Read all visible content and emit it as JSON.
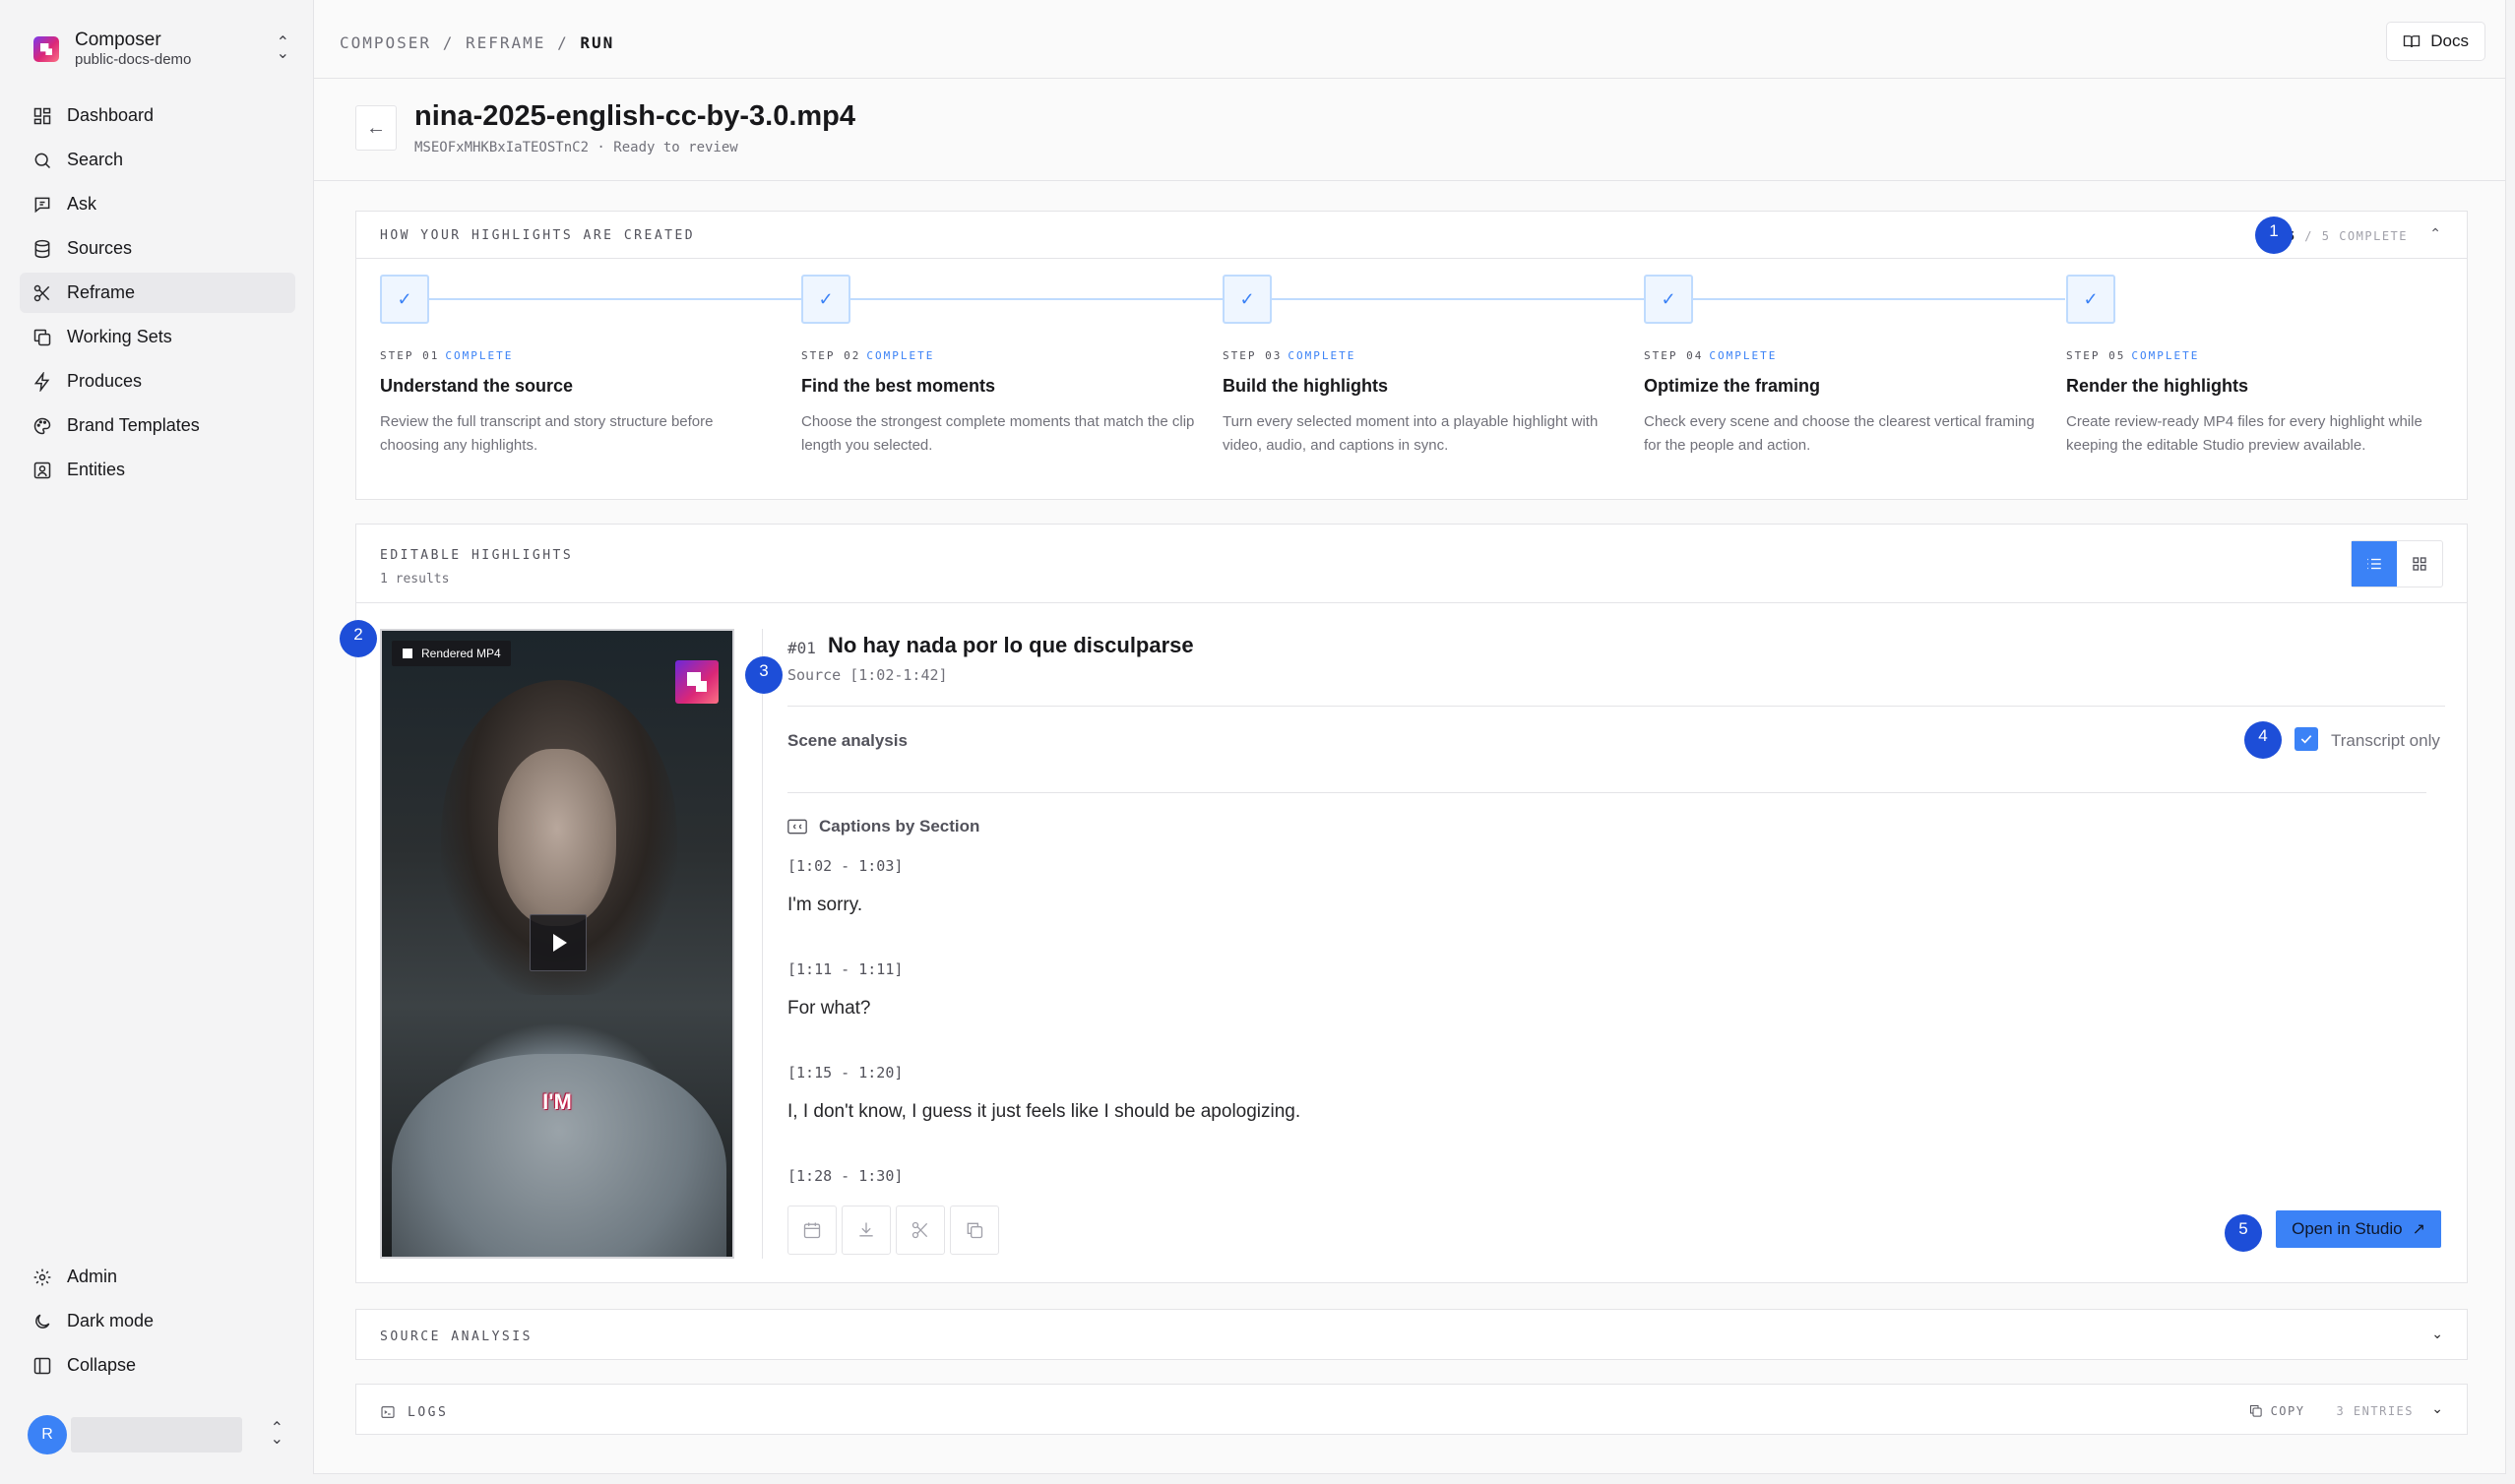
{
  "workspace": {
    "name": "Composer",
    "sub": "public-docs-demo"
  },
  "nav": [
    {
      "label": "Dashboard",
      "icon": "dashboard-icon"
    },
    {
      "label": "Search",
      "icon": "search-icon"
    },
    {
      "label": "Ask",
      "icon": "chat-icon"
    },
    {
      "label": "Sources",
      "icon": "database-icon"
    },
    {
      "label": "Reframe",
      "icon": "scissors-icon"
    },
    {
      "label": "Working Sets",
      "icon": "copy-icon"
    },
    {
      "label": "Produces",
      "icon": "bolt-icon"
    },
    {
      "label": "Brand Templates",
      "icon": "palette-icon"
    },
    {
      "label": "Entities",
      "icon": "person-square-icon"
    }
  ],
  "nav_bottom": [
    {
      "label": "Admin",
      "icon": "gear-icon"
    },
    {
      "label": "Dark mode",
      "icon": "moon-icon"
    },
    {
      "label": "Collapse",
      "icon": "sidebar-icon"
    }
  ],
  "user": {
    "initial": "R"
  },
  "breadcrumb": {
    "part1": "COMPOSER",
    "sep1": "/",
    "part2": "REFRAME",
    "sep2": "/",
    "current": "RUN"
  },
  "docs_label": "Docs",
  "run": {
    "title": "nina-2025-english-cc-by-3.0.mp4",
    "subtitle": "MSEOFxMHKBxIaTEOSTnC2 · Ready to review"
  },
  "steps_panel": {
    "label": "HOW YOUR HIGHLIGHTS ARE CREATED",
    "progress_done": "5",
    "progress_rest": " / 5 COMPLETE",
    "steps": [
      {
        "num": "STEP 01",
        "status": "COMPLETE",
        "title": "Understand the source",
        "desc": "Review the full transcript and story structure before choosing any highlights."
      },
      {
        "num": "STEP 02",
        "status": "COMPLETE",
        "title": "Find the best moments",
        "desc": "Choose the strongest complete moments that match the clip length you selected."
      },
      {
        "num": "STEP 03",
        "status": "COMPLETE",
        "title": "Build the highlights",
        "desc": "Turn every selected moment into a playable highlight with video, audio, and captions in sync."
      },
      {
        "num": "STEP 04",
        "status": "COMPLETE",
        "title": "Optimize the framing",
        "desc": "Check every scene and choose the clearest vertical framing for the people and action."
      },
      {
        "num": "STEP 05",
        "status": "COMPLETE",
        "title": "Render the highlights",
        "desc": "Create review-ready MP4 files for every highlight while keeping the editable Studio preview available."
      }
    ]
  },
  "highlights_panel": {
    "label": "EDITABLE HIGHLIGHTS",
    "count": "1 results",
    "video_badge": "Rendered MP4",
    "video_caption": "I'M",
    "number": "#01",
    "title": "No hay nada por lo que disculparse",
    "source": "Source [1:02-1:42]",
    "scene_label": "Scene analysis",
    "transcript_only_label": "Transcript only",
    "transcript_only_checked": true,
    "captions_label": "Captions by Section",
    "captions": [
      {
        "time": "[1:02 - 1:03]",
        "text": "I'm sorry."
      },
      {
        "time": "[1:11 - 1:11]",
        "text": "For what?"
      },
      {
        "time": "[1:15 - 1:20]",
        "text": "I, I don't know, I guess it just feels like I should be apologizing."
      },
      {
        "time": "[1:28 - 1:30]",
        "text": ""
      }
    ],
    "open_studio_label": "Open in Studio",
    "open_studio_arrow": "↗"
  },
  "source_analysis_label": "SOURCE ANALYSIS",
  "logs": {
    "label": "LOGS",
    "copy_label": "COPY",
    "entries": "3 ENTRIES"
  },
  "markers": [
    "1",
    "2",
    "3",
    "4",
    "5"
  ],
  "colors": {
    "accent": "#3b82f6",
    "marker": "#1d4ed8"
  }
}
